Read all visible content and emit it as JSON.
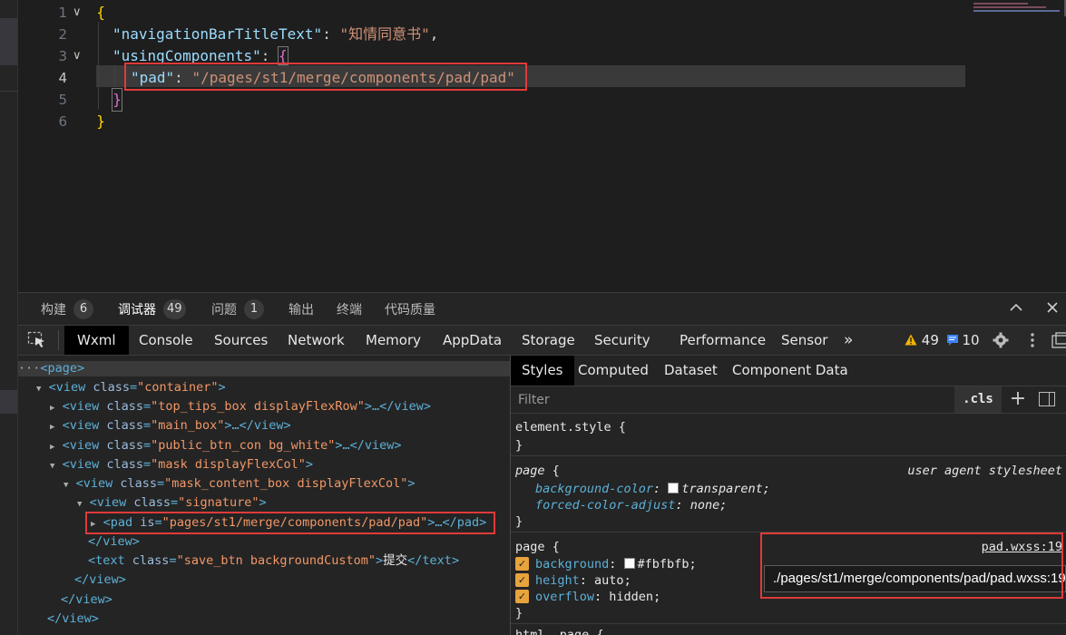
{
  "editor": {
    "lines": [
      {
        "num": "1",
        "code": "{"
      },
      {
        "num": "2",
        "key": "\"navigationBarTitleText\"",
        "colon": ": ",
        "value": "\"知情同意书\"",
        "end": ","
      },
      {
        "num": "3",
        "key": "\"usingComponents\"",
        "colon": ": ",
        "open": "{"
      },
      {
        "num": "4",
        "key": "\"pad\"",
        "colon": ": ",
        "value": "\"/pages/st1/merge/components/pad/pad\""
      },
      {
        "num": "5",
        "code": "}"
      },
      {
        "num": "6",
        "code": "}"
      }
    ]
  },
  "panel_tabs": [
    {
      "label": "构建",
      "badge": "6"
    },
    {
      "label": "调试器",
      "badge": "49"
    },
    {
      "label": "问题",
      "badge": "1"
    },
    {
      "label": "输出"
    },
    {
      "label": "终端"
    },
    {
      "label": "代码质量"
    }
  ],
  "devtools_tabs": [
    "Wxml",
    "Console",
    "Sources",
    "Network",
    "Memory",
    "AppData",
    "Storage",
    "Security",
    "Performance",
    "Sensor"
  ],
  "more_tabs": "»",
  "warnings": {
    "warn_count": "49",
    "info_count": "10"
  },
  "icons": {
    "inspect": "inspect-cursor-icon",
    "warning": "warning-triangle-icon",
    "message": "message-icon",
    "settings": "gear-icon",
    "more": "kebab-icon",
    "dock": "dock-icon",
    "collapse": "chevron-up-icon",
    "close": "close-icon"
  },
  "elements": {
    "rows": [
      {
        "text_open": "<",
        "tag": "page",
        "text_close": ">"
      },
      {
        "tag": "view",
        "attr": "class",
        "val": "\"container\""
      },
      {
        "tag": "view",
        "attr": "class",
        "val": "\"top_tips_box displayFlexRow\"",
        "rest": ">…</view>"
      },
      {
        "tag": "view",
        "attr": "class",
        "val": "\"main_box\"",
        "rest": ">…</view>"
      },
      {
        "tag": "view",
        "attr": "class",
        "val": "\"public_btn_con bg_white\"",
        "rest": ">…</view>"
      },
      {
        "tag": "view",
        "attr": "class",
        "val": "\"mask displayFlexCol\""
      },
      {
        "tag": "view",
        "attr": "class",
        "val": "\"mask_content_box displayFlexCol\""
      },
      {
        "tag": "view",
        "attr": "class",
        "val": "\"signature\""
      },
      {
        "tag": "pad",
        "attr": "is",
        "val": "\"pages/st1/merge/components/pad/pad\"",
        "rest": ">…</pad>"
      },
      {
        "close": "</view>"
      },
      {
        "tag": "text",
        "attr": "class",
        "val": "\"save_btn backgroundCustom\"",
        "inner": "提交",
        "end": "</text>"
      },
      {
        "close": "</view>"
      },
      {
        "close": "</view>"
      },
      {
        "close": "</view>"
      }
    ]
  },
  "styles_tabs": [
    "Styles",
    "Computed",
    "Dataset",
    "Component Data"
  ],
  "filter": {
    "placeholder": "Filter",
    "cls": ".cls",
    "plus": "+"
  },
  "rules": {
    "element_style": "element.style {",
    "close": "}",
    "page_ua": {
      "selector": "page",
      "open": " {",
      "source": "user agent stylesheet",
      "decls": [
        {
          "prop": "background-color",
          "value": "transparent",
          "swatch": "#ffffff"
        },
        {
          "prop": "forced-color-adjust",
          "value": "none"
        }
      ]
    },
    "page_pad": {
      "selector": "page {",
      "source": "pad.wxss:19",
      "decls": [
        {
          "prop": "background",
          "value": "#fbfbfb",
          "swatch": "#fbfbfb"
        },
        {
          "prop": "height",
          "value": "auto"
        },
        {
          "prop": "overflow",
          "value": "hidden"
        }
      ]
    },
    "tooltip": "./pages/st1/merge/components/pad/pad.wxss:19",
    "next_rule": "html, page {"
  },
  "colors": {
    "accent_red": "#e03a3a",
    "checkbox": "#e8a33d"
  }
}
